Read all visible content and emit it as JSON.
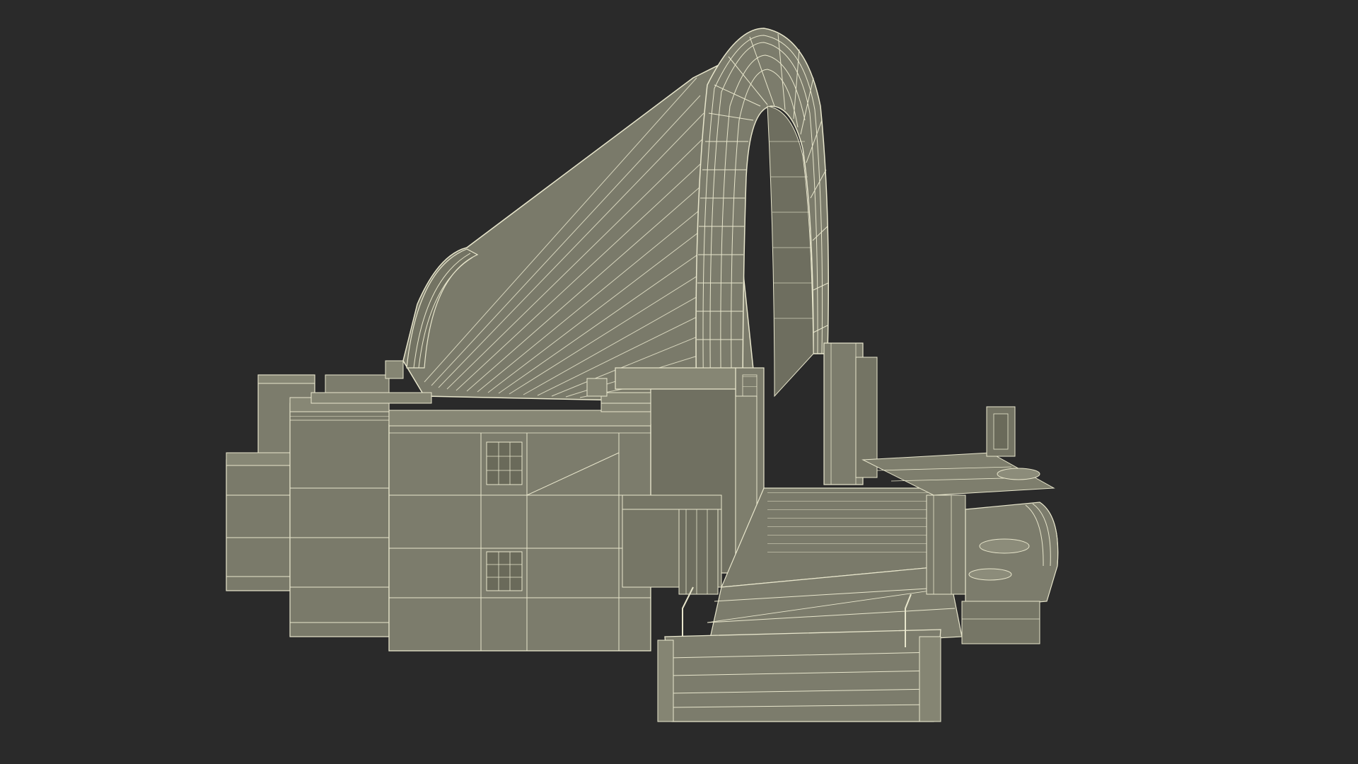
{
  "scene": {
    "background_color": "#2a2a2a",
    "model_fill_color": "#7c7c6c",
    "model_fill_dark": "#6b6b5c",
    "model_fill_light": "#8a8a78",
    "wire_color": "#e8e6cc",
    "subject": "wireframe-building-model"
  }
}
